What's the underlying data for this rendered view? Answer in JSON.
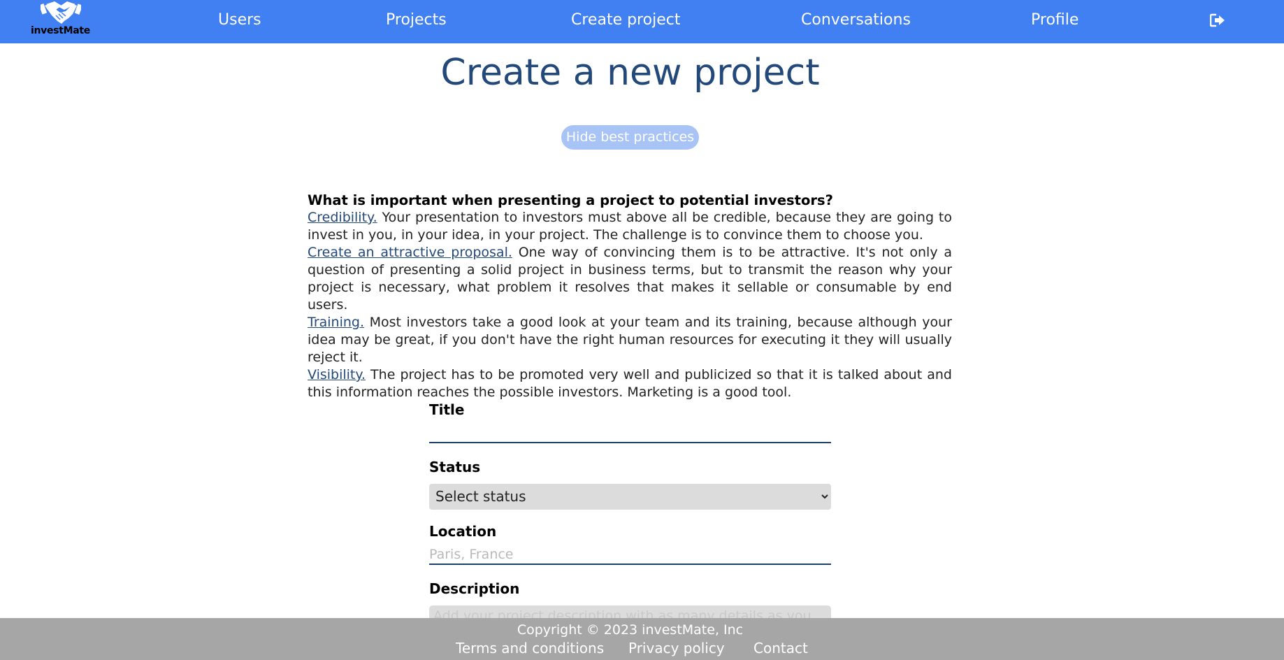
{
  "brand": {
    "name": "investMate",
    "logo_icon": "handshake-icon"
  },
  "nav": {
    "items": [
      {
        "label": "Users"
      },
      {
        "label": "Projects"
      },
      {
        "label": "Create project"
      },
      {
        "label": "Conversations"
      },
      {
        "label": "Profile"
      }
    ],
    "logout_icon": "sign-out-icon"
  },
  "page": {
    "title": "Create a new project",
    "toggle_label": "Hide best practices"
  },
  "practices": {
    "heading": "What is important when presenting a project to potential investors?",
    "items": [
      {
        "link": "Credibility.",
        "text": " Your presentation to investors must above all be credible, because they are going to invest in you, in your idea, in your project. The challenge is to convince them to choose you."
      },
      {
        "link": "Create an attractive proposal.",
        "text": " One way of convincing them is to be attractive. It's not only a question of presenting a solid project in business terms, but to transmit the reason why your project is necessary, what problem it resolves that makes it sellable or consumable by end users."
      },
      {
        "link": "Training.",
        "text": " Most investors take a good look at your team and its training, because although your idea may be great, if you don't have the right human resources for executing it they will usually reject it."
      },
      {
        "link": "Visibility.",
        "text": " The project has to be promoted very well and publicized so that it is talked about and this information reaches the possible investors. Marketing is a good tool."
      }
    ]
  },
  "form": {
    "title_label": "Title",
    "title_value": "",
    "status_label": "Status",
    "status_selected": "Select status",
    "location_label": "Location",
    "location_placeholder": "Paris, France",
    "description_label": "Description",
    "description_placeholder": "Add your project description with as many details as you"
  },
  "footer": {
    "copyright": "Copyright © 2023 investMate, Inc",
    "links": [
      {
        "label": "Terms and conditions"
      },
      {
        "label": "Privacy policy"
      },
      {
        "label": "Contact"
      }
    ]
  },
  "colors": {
    "nav_bg": "#4180f3",
    "title": "#23497a",
    "toggle_bg": "#a8c3f5",
    "footer_bg": "#a6a6a6"
  }
}
